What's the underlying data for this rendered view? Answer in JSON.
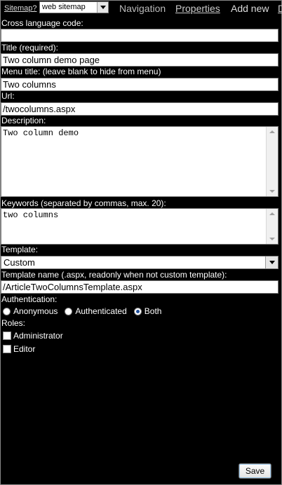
{
  "topbar": {
    "sitemap_link": "Sitemap?",
    "site_select_value": "web sitemap",
    "nav": {
      "navigation": "Navigation",
      "properties": "Properties",
      "add_new": "Add new",
      "more": "D"
    }
  },
  "form": {
    "cross_language": {
      "label": "Cross language code:",
      "value": ""
    },
    "title": {
      "label": "Title (required):",
      "value": "Two column demo page"
    },
    "menu_title": {
      "label": "Menu title: (leave blank to hide from menu)",
      "value": "Two columns"
    },
    "url": {
      "label": "Url:",
      "value": "/twocolumns.aspx"
    },
    "description": {
      "label": "Description:",
      "value": "Two column demo"
    },
    "keywords": {
      "label": "Keywords (separated by commas, max. 20):",
      "value": "two columns"
    },
    "template": {
      "label": "Template:",
      "value": "Custom"
    },
    "template_name": {
      "label": "Template name (.aspx, readonly when not custom template):",
      "value": "/ArticleTwoColumnsTemplate.aspx"
    },
    "authentication": {
      "label": "Authentication:",
      "options": [
        "Anonymous",
        "Authenticated",
        "Both"
      ],
      "selected": "Both"
    },
    "roles": {
      "label": "Roles:",
      "items": [
        {
          "label": "Administrator",
          "checked": false
        },
        {
          "label": "Editor",
          "checked": false
        }
      ]
    },
    "save_label": "Save"
  }
}
